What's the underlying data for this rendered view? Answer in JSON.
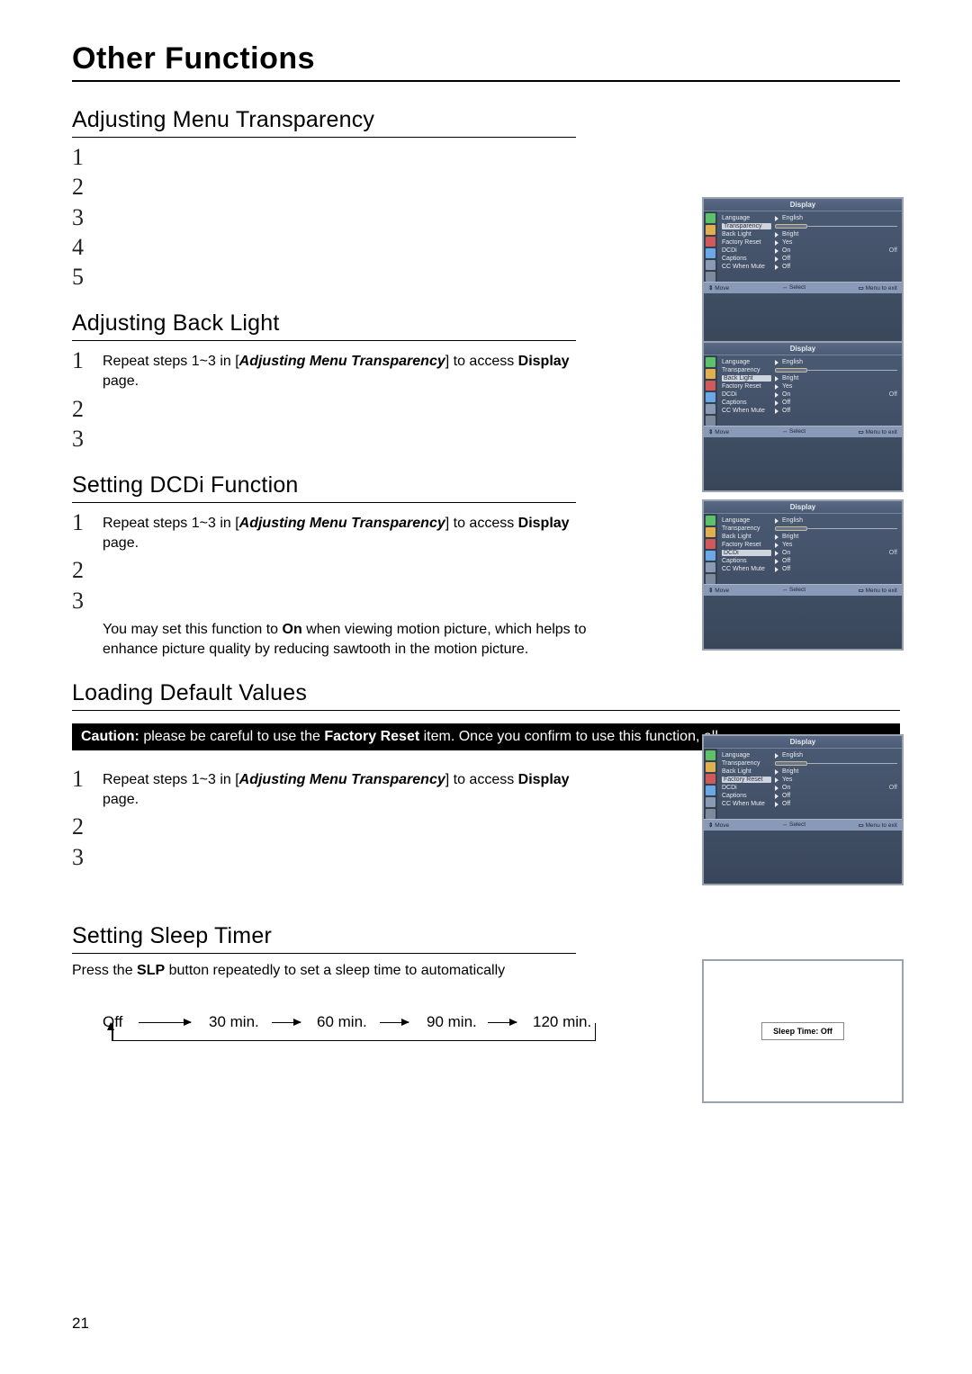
{
  "page": {
    "title": "Other Functions",
    "number": "21"
  },
  "osd": {
    "header": "Display",
    "rows": {
      "language": {
        "label": "Language",
        "value": "English"
      },
      "transparency": {
        "label": "Transparency"
      },
      "backlight": {
        "label": "Back Light",
        "value": "Bright"
      },
      "factory_reset": {
        "label": "Factory Reset",
        "value": "Yes"
      },
      "dcdi": {
        "label": "DCDi",
        "value": "On",
        "right": "Off"
      },
      "captions": {
        "label": "Captions",
        "value": "Off"
      },
      "cc_mute": {
        "label": "CC When Mute",
        "value": "Off"
      }
    },
    "footer": {
      "move": "Move",
      "select": "Select",
      "exit": "Menu to exit"
    }
  },
  "sections": {
    "transparency": {
      "title": "Adjusting Menu Transparency",
      "steps": [
        "1",
        "2",
        "3",
        "4",
        "5"
      ]
    },
    "backlight": {
      "title": "Adjusting Back Light",
      "step1_a": "Repeat steps 1~3 in [",
      "step1_b": "Adjusting Menu Transparency",
      "step1_c": "] to access ",
      "step1_d": "Display",
      "step1_e": " page."
    },
    "dcdi": {
      "title": "Setting DCDi Function",
      "note_a": "You may set this function to ",
      "note_b": "On",
      "note_c": " when viewing motion picture, which helps to enhance picture quality by reducing sawtooth in the motion picture."
    },
    "loading": {
      "title": "Loading Default Values",
      "caution_a": "Caution:",
      "caution_b": " please be careful to use the ",
      "caution_c": "Factory Reset",
      "caution_d": " item. Once you confirm to use this function, all"
    },
    "sleep": {
      "title": "Setting Sleep Timer",
      "text_a": "Press the ",
      "text_b": "SLP",
      "text_c": " button repeatedly to set a sleep time to automatically",
      "flow": [
        "Off",
        "30 min.",
        "60 min.",
        "90 min.",
        "120 min."
      ],
      "box_label": "Sleep Time: Off"
    }
  }
}
